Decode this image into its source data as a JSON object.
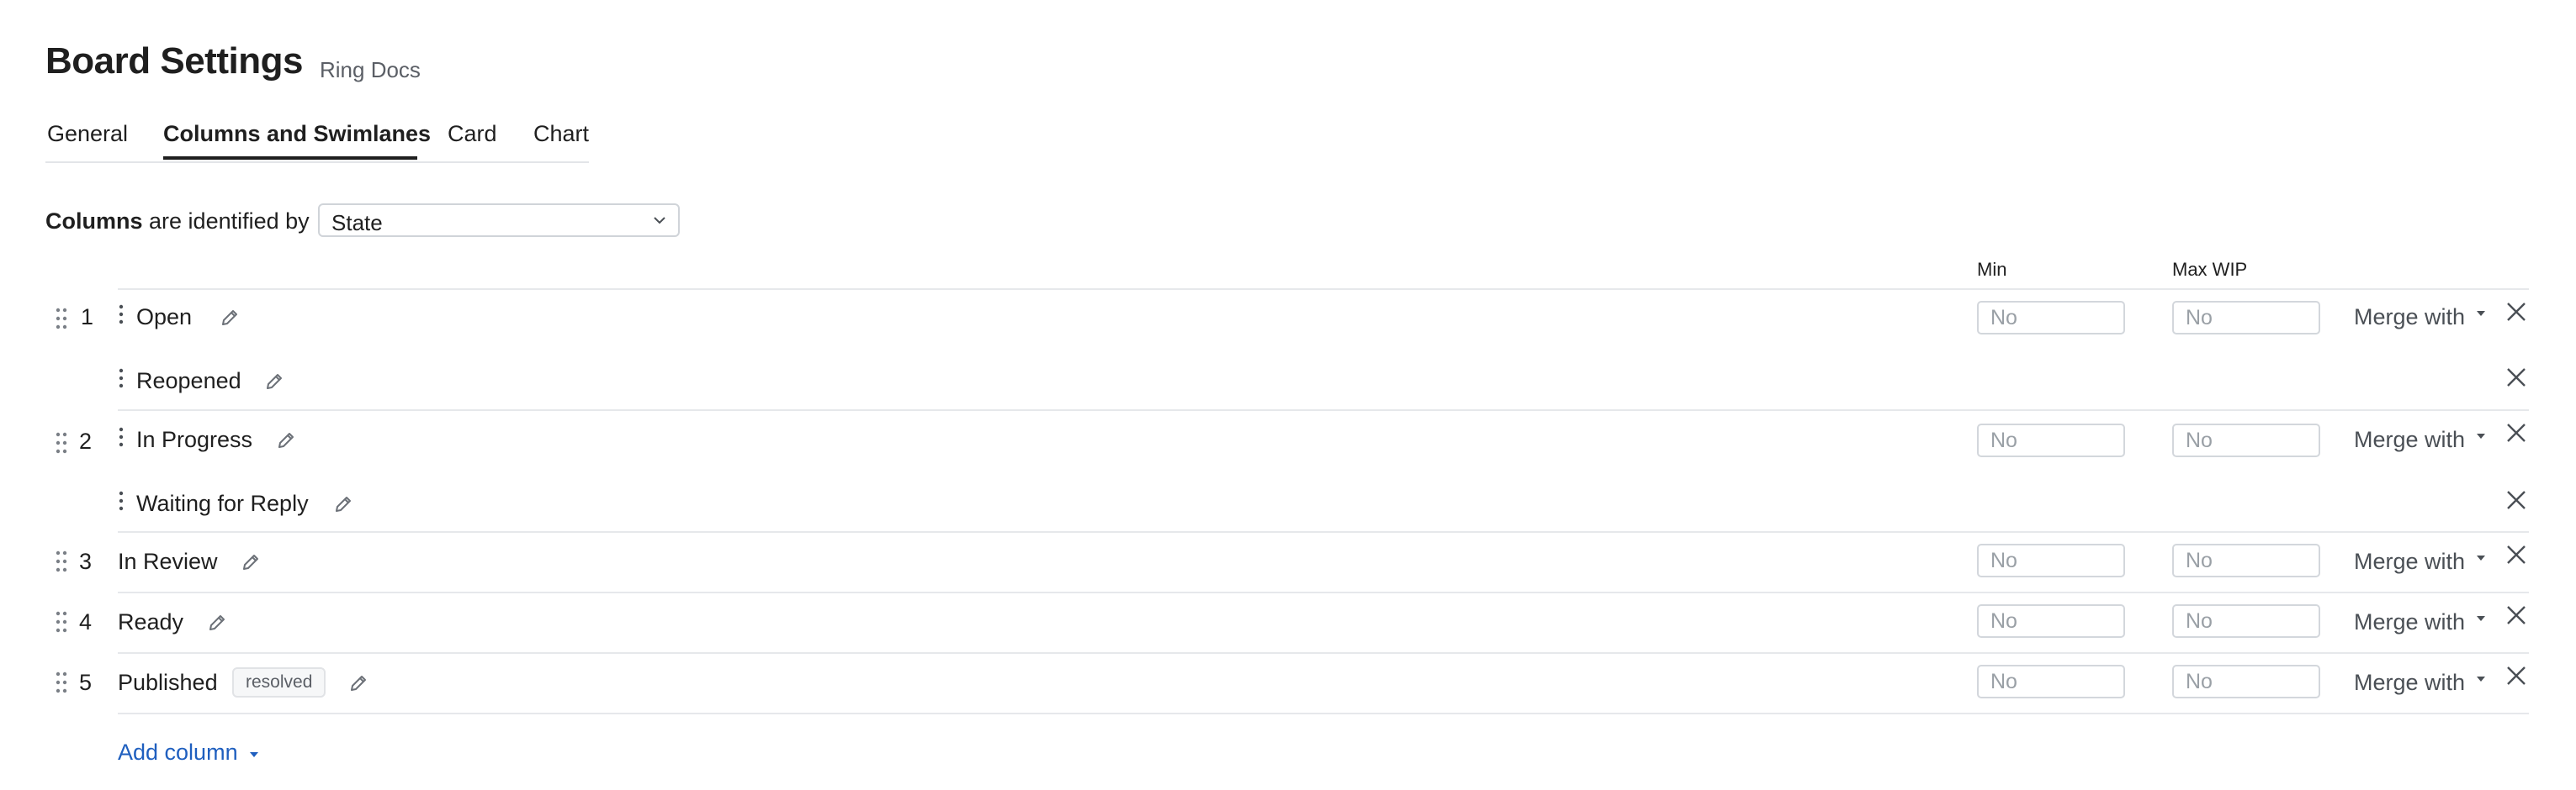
{
  "page": {
    "title": "Board Settings",
    "subtitle": "Ring Docs"
  },
  "tabs": [
    {
      "label": "General",
      "active": false
    },
    {
      "label": "Columns and Swimlanes",
      "active": true
    },
    {
      "label": "Card",
      "active": false
    },
    {
      "label": "Chart",
      "active": false
    }
  ],
  "columns_by": {
    "prefix": "Columns",
    "suffix": "are identified by",
    "selected": "State"
  },
  "headers": {
    "min": "Min",
    "max_wip": "Max WIP"
  },
  "rows": [
    {
      "num": "1",
      "label": "Open",
      "min_placeholder": "No",
      "max_placeholder": "No",
      "merge": "Merge with"
    },
    {
      "num": "",
      "label": "Reopened"
    },
    {
      "num": "2",
      "label": "In Progress",
      "min_placeholder": "No",
      "max_placeholder": "No",
      "merge": "Merge with"
    },
    {
      "num": "",
      "label": "Waiting for Reply"
    },
    {
      "num": "3",
      "label": "In Review",
      "min_placeholder": "No",
      "max_placeholder": "No",
      "merge": "Merge with"
    },
    {
      "num": "4",
      "label": "Ready",
      "min_placeholder": "No",
      "max_placeholder": "No",
      "merge": "Merge with"
    },
    {
      "num": "5",
      "label": "Published",
      "badge": "resolved",
      "min_placeholder": "No",
      "max_placeholder": "No",
      "merge": "Merge with"
    }
  ],
  "add_column": "Add column",
  "colors": {
    "accent": "#1f5fbf",
    "text": "#1f1f1f",
    "muted": "#5b5f66",
    "border": "#d3d7dc"
  },
  "icons": {
    "grip": "drag-grip-icon",
    "edit": "pencil-icon",
    "remove": "close-icon",
    "dropdown": "chevron-down-icon"
  }
}
